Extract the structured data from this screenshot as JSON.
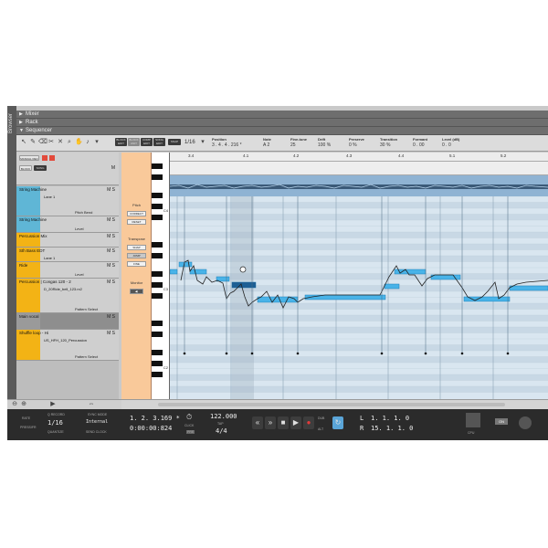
{
  "sidebar_label": "Browser",
  "panels": {
    "mixer": "Mixer",
    "rack": "Rack",
    "sequencer": "Sequencer"
  },
  "toolbar": {
    "snap_label": "SNAP",
    "snap_value": "1/16",
    "mode_buttons": [
      "BLOCK\nEDIT",
      "BLOCK\nUNIT",
      "COMP\nEDIT",
      "SONG\nEDIT"
    ],
    "fields": [
      {
        "label": "Position",
        "value": "3 . 4 . 4 . 216 *"
      },
      {
        "label": "Note",
        "value": "A 2"
      },
      {
        "label": "Fine-tune",
        "value": "25"
      },
      {
        "label": "Drift",
        "value": "100 %"
      },
      {
        "label": "Preserve",
        "value": "0 %"
      },
      {
        "label": "Transition",
        "value": "30 %"
      },
      {
        "label": "Formant",
        "value": "0 . 00"
      },
      {
        "label": "Level (dB)",
        "value": "0 . 0"
      }
    ]
  },
  "tracklist": {
    "manual_rec": "MANUAL REC",
    "block": "BLOCK",
    "song": "SONG",
    "tracks": [
      {
        "name": "String Machine",
        "lane": "Lane 1",
        "param": "Pitch Bend",
        "color": "#5fb6d6"
      },
      {
        "name": "String Machine",
        "lane": "",
        "param": "Level",
        "color": "#5fb6d6"
      },
      {
        "name": "Percussion Mix",
        "lane": "",
        "param": "",
        "color": "#f3b315"
      },
      {
        "name": "Sth Bass EDT",
        "lane": "Lane 1",
        "param": "",
        "color": "#f3b315"
      },
      {
        "name": "Ride",
        "lane": "",
        "param": "Level",
        "color": "#f3b315"
      },
      {
        "name": "Percussion | Congas 120 - 2",
        "lane": "D_20Ride_bell_123.rx2",
        "param": "Pattern Select",
        "color": "#f3b315"
      },
      {
        "name": "Main vocal",
        "lane": "",
        "param": "",
        "color": "#9a9a9a"
      },
      {
        "name": "Shuffle loop - Hi",
        "lane": "US_HFH_120_Percussion",
        "param": "Pattern Select",
        "color": "#f3b315"
      }
    ]
  },
  "pitch_panel": {
    "pitch": "Pitch",
    "correct": "CORRECT",
    "reset": "RESET",
    "transpose": "Transpose",
    "buttons": [
      "SNAP",
      "JUMP",
      "FINE"
    ],
    "monitor": "Monitor"
  },
  "keys": {
    "c4": "C4",
    "c3": "C3",
    "c2": "C2"
  },
  "editor": {
    "close_label": "CLOSE",
    "ruler": [
      "3.4",
      "4.1",
      "4.2",
      "4.3",
      "4.4",
      "5.1",
      "5.2"
    ],
    "ruler_sub": "3.4"
  },
  "transport": {
    "rate_label": "RATE",
    "rate_value": "PRESSIFR",
    "quantize_label": "Q RECORD",
    "quantize_value": "1/16",
    "quantize_sub": "QUANTIZE",
    "sync_label": "SYNC MODE",
    "sync_value": "Internal",
    "send_clock": "SEND CLOCK",
    "position": "1. 2. 3.169 *",
    "time": "0:00:00:824",
    "click_label": "CLICK",
    "pre_label": "PRE",
    "tempo": "122.000",
    "tap": "TAP",
    "signature": "4/4",
    "l_label": "L",
    "l_value": "1. 1. 1. 0",
    "r_label": "R",
    "r_value": "15. 1. 1. 0",
    "alt": "ALT",
    "dub": "DUB",
    "on": "ON",
    "cpu": "CPU"
  }
}
